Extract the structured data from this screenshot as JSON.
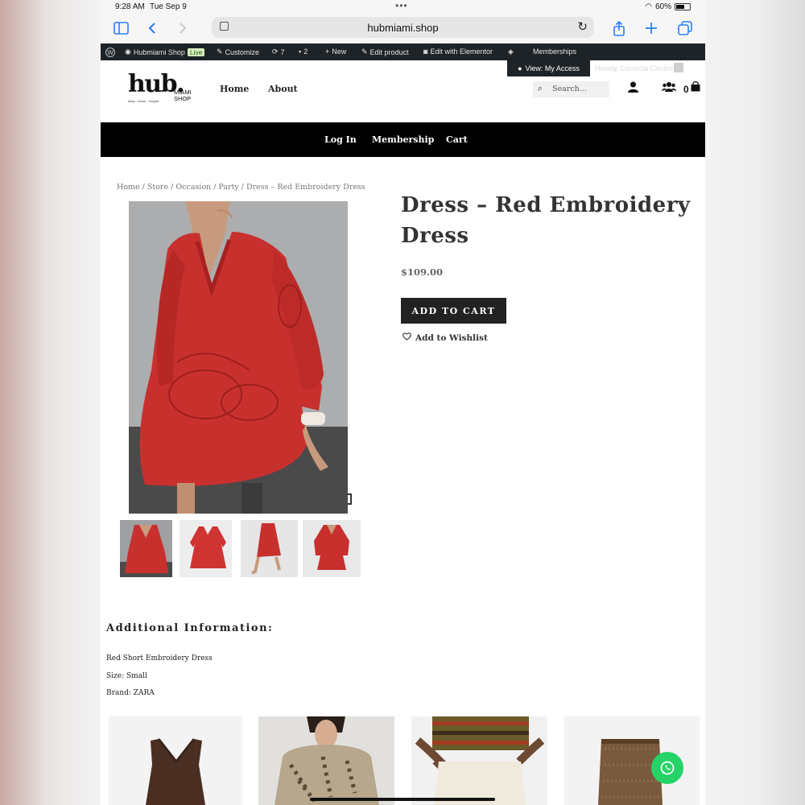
{
  "status": {
    "time": "9:28 AM",
    "date": "Tue Sep 9",
    "battery": "60%"
  },
  "browser": {
    "url": "hubmiami.shop"
  },
  "admin_bar": {
    "site": "Hubmiami Shop",
    "live": "Live",
    "customize": "Customize",
    "updates": "7",
    "comments": "2",
    "new": "New",
    "edit_product": "Edit product",
    "elementor": "Edit with Elementor",
    "memberships": "Memberships",
    "view_access": "View: My Access",
    "account_faded": "Howdy, Lucrecia Cardini"
  },
  "header": {
    "logo_main": "hub.",
    "logo_sub": "MIAMI SHOP",
    "logo_tag": "shop · reuse · recycle",
    "nav": [
      "Home",
      "About"
    ],
    "search_placeholder": "Search...",
    "cart_count": "0"
  },
  "menu": [
    "Log In",
    "Membership",
    "Cart"
  ],
  "breadcrumb": "Home / Store / Occasion / Party / Dress – Red Embroidery Dress",
  "product": {
    "title": "Dress – Red Embroidery Dress",
    "price": "$109.00",
    "add_to_cart": "ADD TO CART",
    "wishlist": "Add to Wishlist"
  },
  "additional": {
    "title": "Additional Information:",
    "lines": [
      "Red Short Embroidery Dress",
      "Size: Small",
      "Brand: ZARA"
    ]
  },
  "colors": {
    "dress": "#c8302e",
    "accent_black": "#000000",
    "whatsapp": "#25d366",
    "adminbar": "#1d2327"
  }
}
